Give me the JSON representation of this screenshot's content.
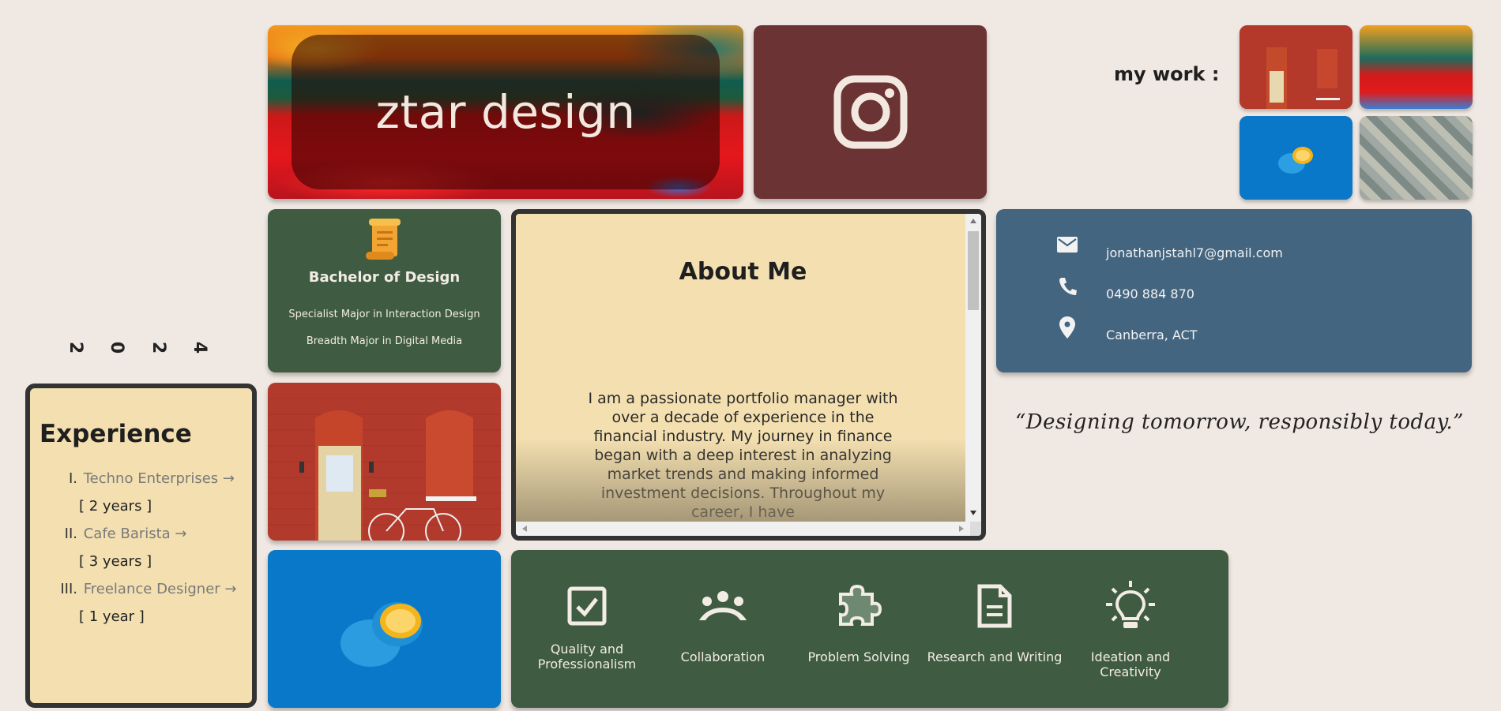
{
  "year": [
    "2",
    "0",
    "2",
    "4"
  ],
  "hero": {
    "title": "ztar design"
  },
  "instagram": {
    "icon": "instagram-icon"
  },
  "my_work": {
    "label": "my work :",
    "thumbnails": [
      "brick-door-photo",
      "abstract-paint-photo",
      "orange-photo",
      "tiles-photo"
    ]
  },
  "degree": {
    "icon": "scroll-icon",
    "title": "Bachelor of Design",
    "line1": "Specialist Major in Interaction Design",
    "line2": "Breadth Major in Digital Media"
  },
  "about": {
    "title": "About Me",
    "text": "I am a passionate portfolio manager with over a decade of experience in the financial industry. My journey in finance began with a deep interest in analyzing market trends and making informed investment decisions. Throughout my career, I have"
  },
  "contact": {
    "email": "jonathanjstahl7@gmail.com",
    "phone": "0490 884 870",
    "location": "Canberra, ACT"
  },
  "quote": "“Designing tomorrow, responsibly today.”",
  "experience": {
    "title": "Experience",
    "items": [
      {
        "num": "I.",
        "name": "Techno Enterprises →",
        "duration": "[ 2 years ]"
      },
      {
        "num": "II.",
        "name": "Cafe Barista →",
        "duration": "[ 3 years ]"
      },
      {
        "num": "III.",
        "name": "Freelance Designer →",
        "duration": "[ 1 year ]"
      }
    ]
  },
  "skills": [
    {
      "icon": "checkbox-icon",
      "label": "Quality and Professionalism"
    },
    {
      "icon": "group-icon",
      "label": "Collaboration"
    },
    {
      "icon": "puzzle-icon",
      "label": "Problem Solving"
    },
    {
      "icon": "document-icon",
      "label": "Research and Writing"
    },
    {
      "icon": "lightbulb-icon",
      "label": "Ideation and Creativity"
    }
  ],
  "colors": {
    "background": "#f0e8e2",
    "green": "#3f5c42",
    "blue": "#44657f",
    "maroon": "#6b3333",
    "cream": "#f3dfb0"
  }
}
